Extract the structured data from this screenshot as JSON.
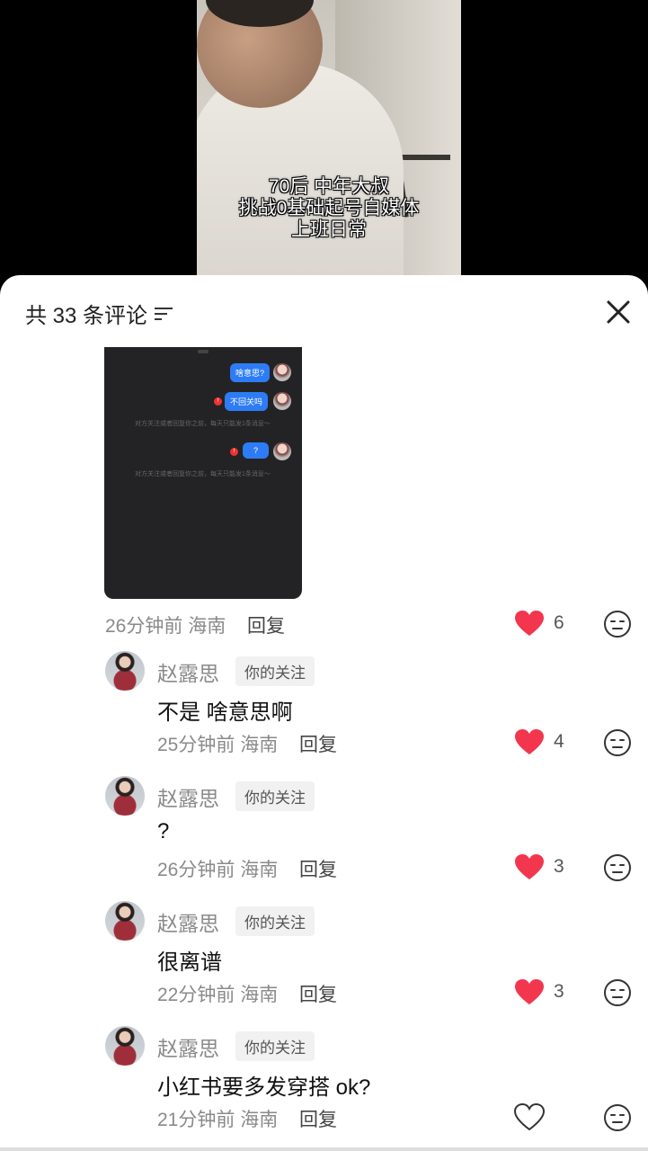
{
  "video": {
    "caption_lines": [
      "70后 中年大叔",
      "挑战0基础起号自媒体",
      "上班日常"
    ]
  },
  "header": {
    "title": "共 33 条评论",
    "filter_icon": "filter-icon",
    "close_icon": "close-icon"
  },
  "screenshot_image": {
    "bubbles": [
      "啥意思?",
      "不回关吗",
      "?"
    ],
    "system_lines": [
      "对方关注或者回复你之前，每天只能发1条消息～",
      "对方关注或者回复你之前，每天只能发1条消息～"
    ]
  },
  "top_meta": {
    "time": "26分钟前",
    "location": "海南",
    "reply": "回复",
    "likes": "6"
  },
  "comments": [
    {
      "name": "赵露思",
      "tag": "你的关注",
      "text": "不是 啥意思啊",
      "time": "25分钟前",
      "location": "海南",
      "reply": "回复",
      "likes": "4"
    },
    {
      "name": "赵露思",
      "tag": "你的关注",
      "text": "?",
      "time": "26分钟前",
      "location": "海南",
      "reply": "回复",
      "likes": "3"
    },
    {
      "name": "赵露思",
      "tag": "你的关注",
      "text": "很离谱",
      "time": "22分钟前",
      "location": "海南",
      "reply": "回复",
      "likes": "3"
    },
    {
      "name": "赵露思",
      "tag": "你的关注",
      "text": "小红书要多发穿搭 ok?",
      "time": "21分钟前",
      "location": "海南",
      "reply": "回复",
      "likes": ""
    }
  ],
  "colors": {
    "heart": "#f2364d",
    "accent_bubble": "#2d7cf6"
  }
}
